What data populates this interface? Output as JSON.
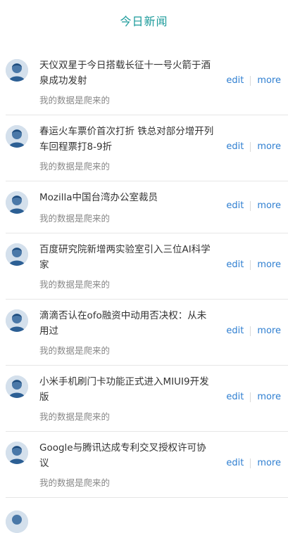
{
  "header": {
    "title": "今日新闻"
  },
  "news": [
    {
      "title": "天仪双星于今日搭载长征十一号火箭于酒泉成功发射",
      "sub": "我的数据是爬来的",
      "edit": "edit",
      "more": "more"
    },
    {
      "title": "春运火车票价首次打折 铁总对部分增开列车回程票打8-9折",
      "sub": "我的数据是爬来的",
      "edit": "edit",
      "more": "more"
    },
    {
      "title": "Mozilla中国台湾办公室裁员",
      "sub": "我的数据是爬来的",
      "edit": "edit",
      "more": "more"
    },
    {
      "title": "百度研究院新增两实验室引入三位AI科学家",
      "sub": "我的数据是爬来的",
      "edit": "edit",
      "more": "more"
    },
    {
      "title": "滴滴否认在ofo融资中动用否决权：从未用过",
      "sub": "我的数据是爬来的",
      "edit": "edit",
      "more": "more"
    },
    {
      "title": "小米手机刷门卡功能正式进入MIUI9开发版",
      "sub": "我的数据是爬来的",
      "edit": "edit",
      "more": "more"
    },
    {
      "title": "Google与腾讯达成专利交叉授权许可协议",
      "sub": "我的数据是爬来的",
      "edit": "edit",
      "more": "more"
    }
  ],
  "icons": {
    "avatar": "user-avatar-icon"
  },
  "colors": {
    "accent": "#1a9a9a",
    "link": "#2f7fd1",
    "muted": "#888888"
  }
}
